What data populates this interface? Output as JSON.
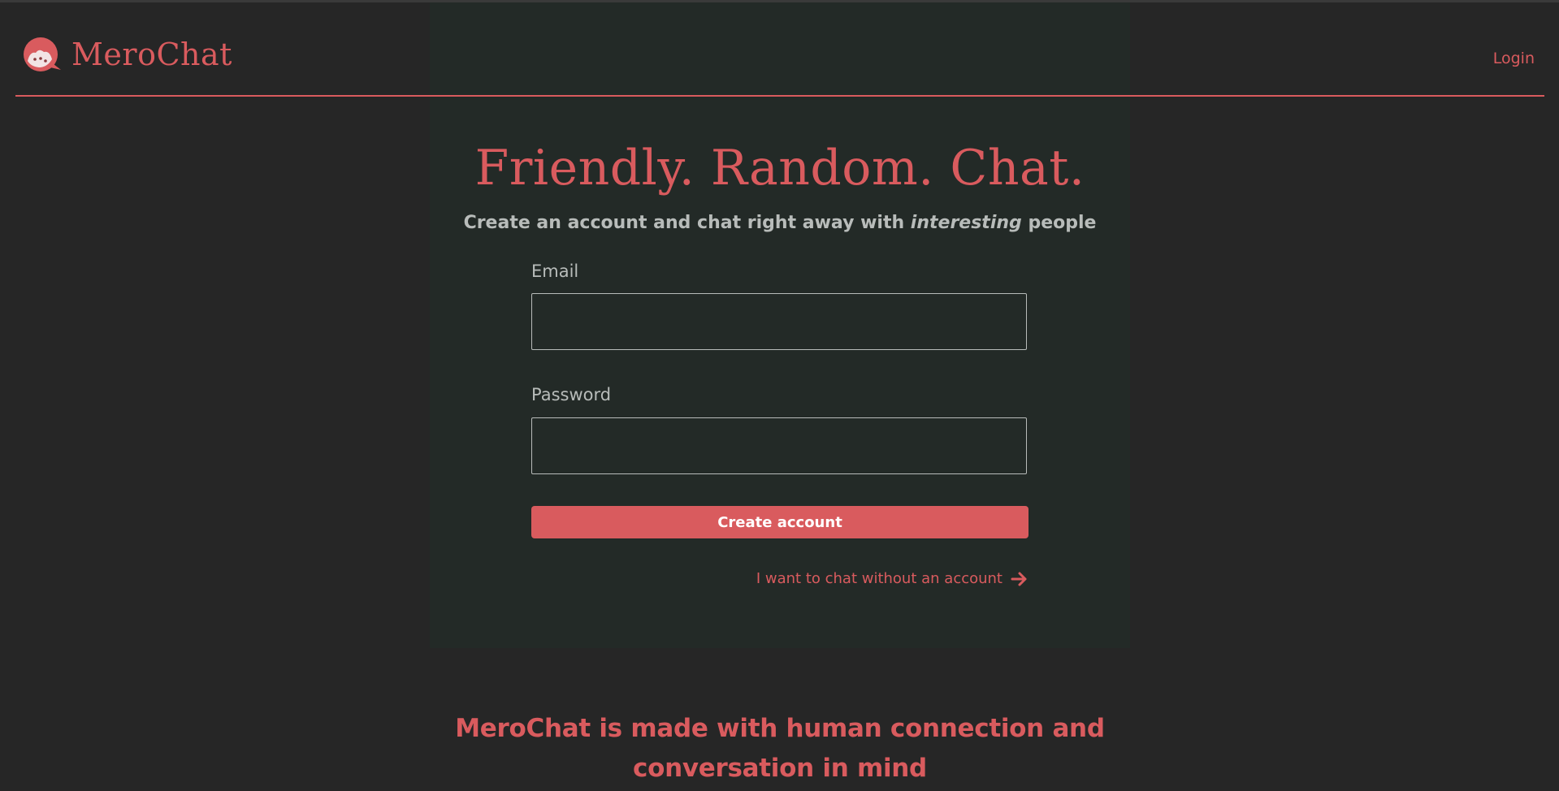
{
  "brand": {
    "name": "MeroChat",
    "icon": "merochat-logo-icon",
    "accent_color": "#d95b5e"
  },
  "nav": {
    "login_label": "Login"
  },
  "hero": {
    "headline": "Friendly. Random. Chat.",
    "sub_before": "Create an account and chat right away with ",
    "sub_emphasis": "interesting",
    "sub_after": " people"
  },
  "form": {
    "email_label": "Email",
    "email_value": "",
    "password_label": "Password",
    "password_value": "",
    "submit_label": "Create account",
    "guest_link_label": "I want to chat without an account",
    "guest_link_icon": "arrow-right-icon"
  },
  "footer": {
    "tagline_line1": "MeroChat is made with human connection and",
    "tagline_line2": "conversation in mind"
  }
}
